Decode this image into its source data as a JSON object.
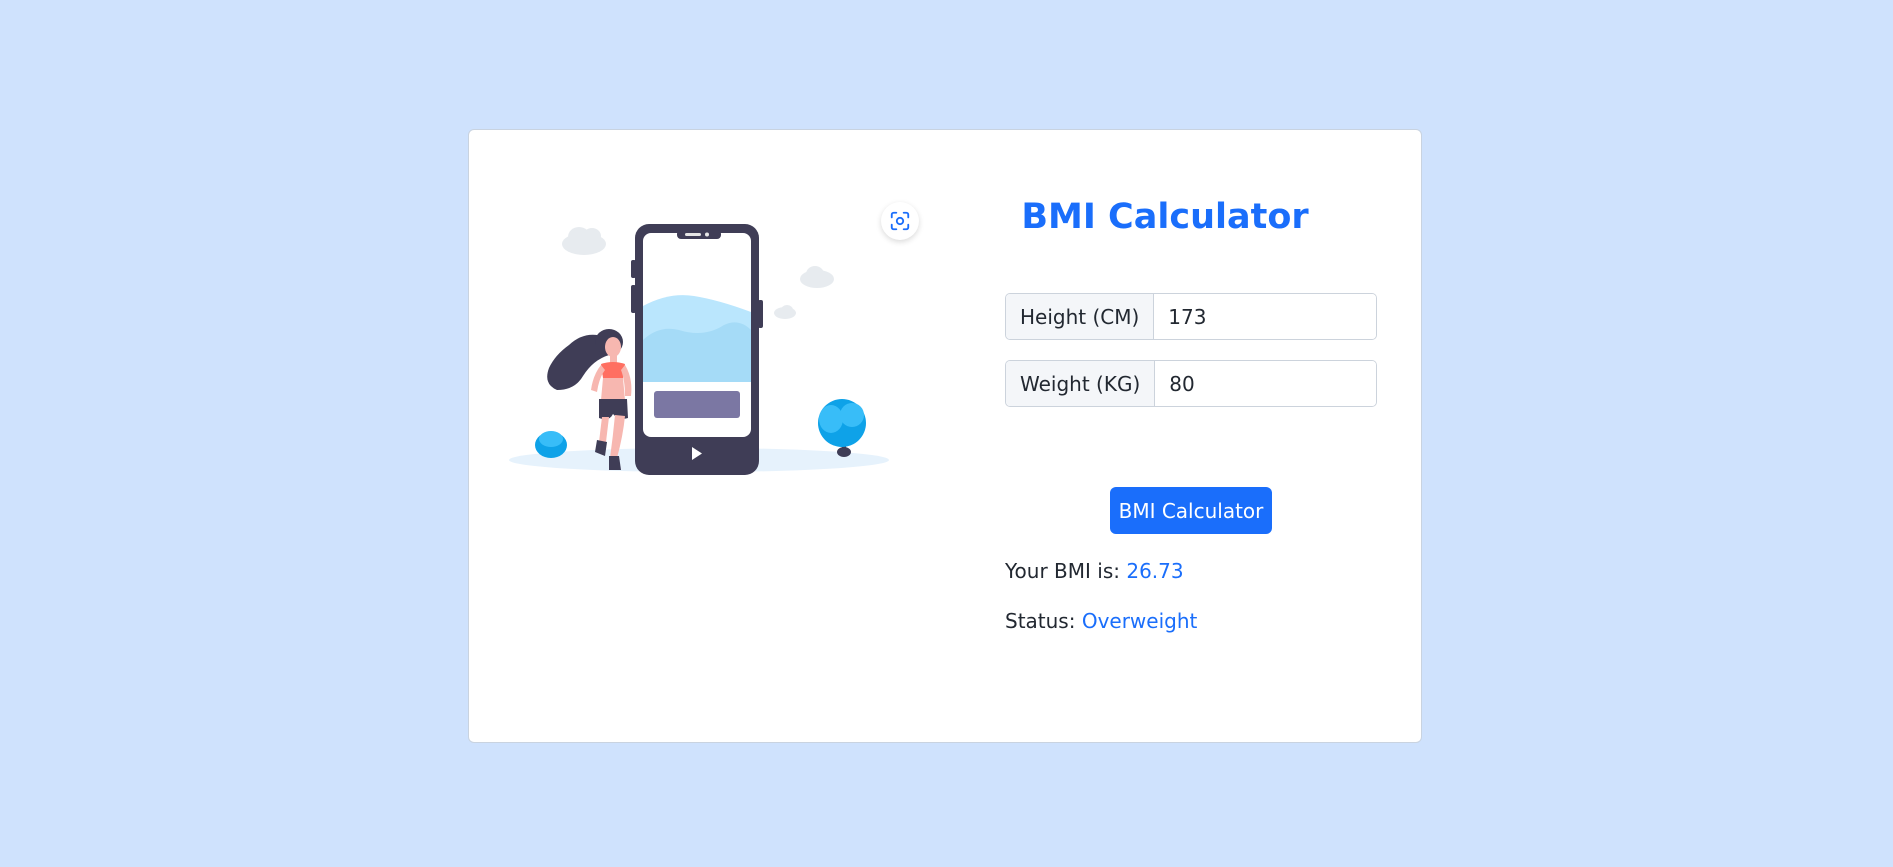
{
  "app": {
    "title": "BMI Calculator"
  },
  "form": {
    "height": {
      "label": "Height (CM)",
      "value": "173"
    },
    "weight": {
      "label": "Weight (KG)",
      "value": "80"
    },
    "submit_label": "BMI Calculator"
  },
  "result": {
    "bmi_label": "Your BMI is:",
    "bmi_value": "26.73",
    "status_label": "Status:",
    "status_value": "Overweight"
  },
  "icons": {
    "scan": "scan-icon",
    "illustration": "fitness-illustration"
  },
  "colors": {
    "background": "#cfe2fd",
    "accent": "#1a6efb",
    "card": "#ffffff"
  }
}
